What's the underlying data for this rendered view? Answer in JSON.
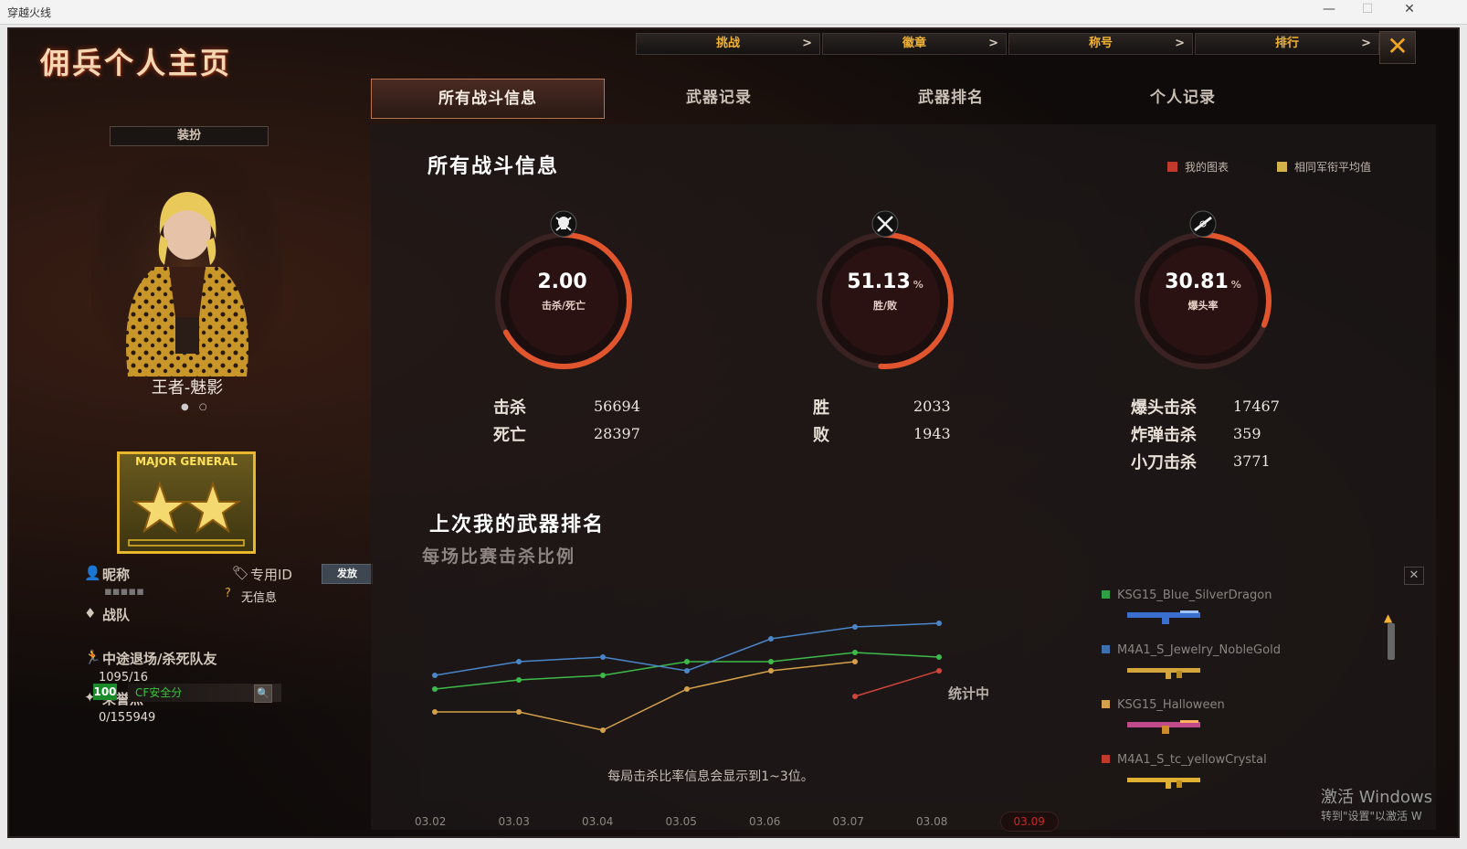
{
  "window": {
    "title": "穿越火线",
    "min": "—",
    "max": "☐",
    "close": "✕"
  },
  "page_title": "佣兵个人主页",
  "top_tabs": [
    {
      "label": "挑战",
      "arrow": ">"
    },
    {
      "label": "徽章",
      "arrow": ">"
    },
    {
      "label": "称号",
      "arrow": ">"
    },
    {
      "label": "排行",
      "arrow": ">"
    }
  ],
  "close_button": "✕",
  "sub_tabs": [
    "所有战斗信息",
    "武器记录",
    "武器排名",
    "个人记录"
  ],
  "left": {
    "dress_button": "装扮",
    "character_name": "王者-魅影",
    "rank_text": "MAJOR GENERAL",
    "nickname_label": "昵称",
    "nickname_value": "▪▪▪▪▪",
    "id_label": "专用ID",
    "send_button": "发放",
    "no_info": "无信息",
    "team_label": "战队",
    "quit_label": "中途退场/杀死队友",
    "quit_value": "1095/16",
    "honor_label": "荣誉点",
    "honor_value": "0/155949",
    "safety_score": "100",
    "safety_label": "CF安全分"
  },
  "main": {
    "title": "所有战斗信息",
    "legend": [
      {
        "label": "我的图表",
        "color": "#c0392b"
      },
      {
        "label": "相同军衔平均值",
        "color": "#d4b24a"
      }
    ],
    "gauges": [
      {
        "value": "2.00",
        "unit": "",
        "caption": "击杀/死亡",
        "fill": 0.67
      },
      {
        "value": "51.13",
        "unit": "%",
        "caption": "胜/败",
        "fill": 0.51
      },
      {
        "value": "30.81",
        "unit": "%",
        "caption": "爆头率",
        "fill": 0.31
      }
    ],
    "stats": {
      "kills_label": "击杀",
      "kills": "56694",
      "deaths_label": "死亡",
      "deaths": "28397",
      "wins_label": "胜",
      "wins": "2033",
      "losses_label": "败",
      "losses": "1943",
      "headshot_label": "爆头击杀",
      "headshot": "17467",
      "bomb_label": "炸弹击杀",
      "bomb": "359",
      "knife_label": "小刀击杀",
      "knife": "3771"
    },
    "weapon_title": "上次我的武器排名",
    "weapon_subtitle": "每场比赛击杀比例",
    "counting_label": "统计中",
    "chart_note": "每局击杀比率信息会显示到1~3位。",
    "weapons": [
      {
        "name": "KSG15_Blue_SilverDragon",
        "color": "#2ea043"
      },
      {
        "name": "M4A1_S_Jewelry_NobleGold",
        "color": "#3a6fb0"
      },
      {
        "name": "KSG15_Halloween",
        "color": "#d4a04a"
      },
      {
        "name": "M4A1_S_tc_yellowCrystal",
        "color": "#c0392b"
      }
    ]
  },
  "chart_data": {
    "type": "line",
    "categories": [
      "03.02",
      "03.03",
      "03.04",
      "03.05",
      "03.06",
      "03.07",
      "03.08",
      "03.09"
    ],
    "selected": "03.09",
    "series": [
      {
        "name": "KSG15_Blue_SilverDragon",
        "color": "#3dbb4a",
        "values": [
          0.2,
          0.3,
          0.35,
          0.5,
          0.5,
          0.6,
          0.55,
          null
        ]
      },
      {
        "name": "M4A1_S_Jewelry_NobleGold",
        "color": "#4a86c8",
        "values": [
          0.35,
          0.5,
          0.55,
          0.4,
          0.75,
          0.88,
          0.92,
          null
        ]
      },
      {
        "name": "KSG15_Halloween",
        "color": "#d4a04a",
        "values": [
          -0.05,
          -0.05,
          -0.25,
          0.2,
          0.4,
          0.5,
          null,
          null
        ]
      },
      {
        "name": "M4A1_S_tc_yellowCrystal",
        "color": "#d0453a",
        "values": [
          null,
          null,
          null,
          null,
          null,
          0.12,
          0.4,
          null
        ]
      }
    ]
  },
  "watermark": {
    "line1": "激活 Windows",
    "line2": "转到\"设置\"以激活 W"
  }
}
